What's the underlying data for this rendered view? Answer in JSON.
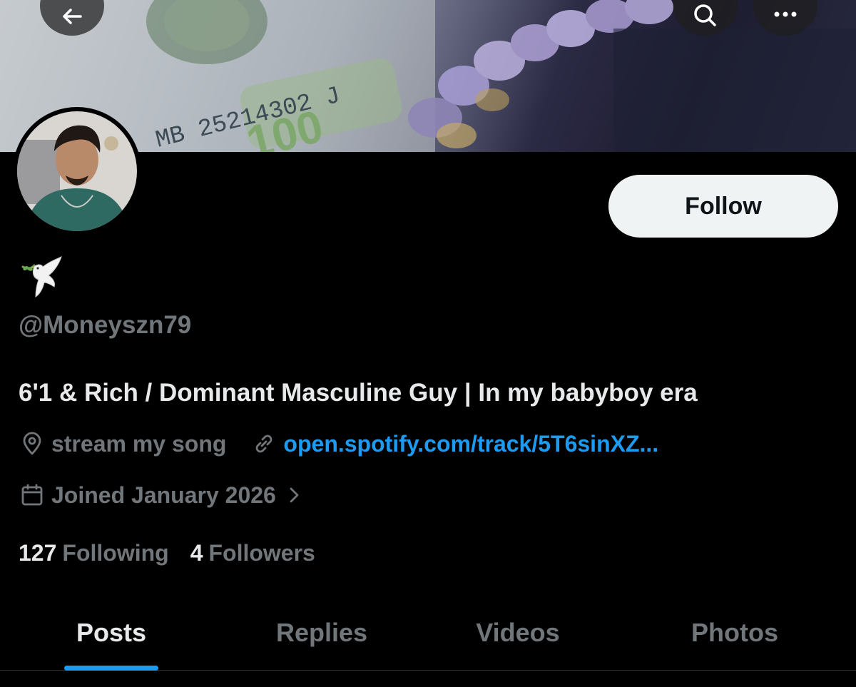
{
  "banner": {
    "bill_serial": "MB 25214302 J",
    "bill_denomination": "100"
  },
  "header": {
    "back_icon": "arrow-left-icon",
    "search_icon": "search-icon",
    "more_icon": "more-horizontal-icon"
  },
  "profile": {
    "display_name_emoji": "🕊️",
    "handle": "@Moneyszn79",
    "bio": "6'1 & Rich / Dominant Masculine Guy | In my babyboy era",
    "location": "stream my song",
    "link": "open.spotify.com/track/5T6sinXZ...",
    "joined": "Joined January 2026"
  },
  "actions": {
    "follow_label": "Follow"
  },
  "stats": {
    "following_count": "127",
    "following_label": "Following",
    "followers_count": "4",
    "followers_label": "Followers"
  },
  "tabs": [
    {
      "label": "Posts",
      "active": true
    },
    {
      "label": "Replies",
      "active": false
    },
    {
      "label": "Videos",
      "active": false
    },
    {
      "label": "Photos",
      "active": false
    }
  ],
  "colors": {
    "accent": "#1d9bf0",
    "muted": "#71767b",
    "text": "#e7e9ea",
    "background": "#000000",
    "follow_button_bg": "#eff3f4"
  }
}
